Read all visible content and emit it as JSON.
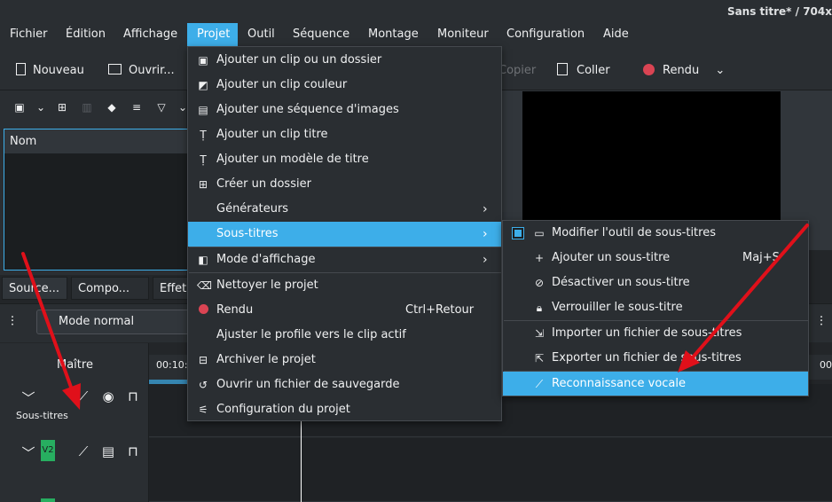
{
  "window": {
    "title": "Sans titre* / 704x"
  },
  "menubar": [
    {
      "label": "Fichier"
    },
    {
      "label": "Édition"
    },
    {
      "label": "Affichage"
    },
    {
      "label": "Projet"
    },
    {
      "label": "Outil"
    },
    {
      "label": "Séquence"
    },
    {
      "label": "Montage"
    },
    {
      "label": "Moniteur"
    },
    {
      "label": "Configuration"
    },
    {
      "label": "Aide"
    }
  ],
  "toolbar": {
    "new_label": "Nouveau",
    "open_label": "Ouvrir...",
    "copy_label": "Copier",
    "paste_label": "Coller",
    "render_label": "Rendu"
  },
  "bin": {
    "column_header": "Nom"
  },
  "tabs": [
    "Source...",
    "Compo...",
    "Effet"
  ],
  "mode": {
    "label": "Mode normal"
  },
  "timeline": {
    "master_label": "Maître",
    "ruler_time": "00:10:",
    "ruler_right": "00",
    "subtitles_track": "Sous-titres",
    "v2_track": "V2"
  },
  "project_menu": {
    "items": [
      {
        "label": "Ajouter un clip ou un dossier",
        "icon": "add-clip-icon"
      },
      {
        "label": "Ajouter un clip couleur",
        "icon": "color-clip-icon"
      },
      {
        "label": "Ajouter une séquence d'images",
        "icon": "image-sequence-icon"
      },
      {
        "label": "Ajouter un clip titre",
        "icon": "title-clip-icon"
      },
      {
        "label": "Ajouter un modèle de titre",
        "icon": "title-template-icon"
      },
      {
        "label": "Créer un dossier",
        "icon": "folder-add-icon"
      },
      {
        "label": "Générateurs",
        "icon": ""
      },
      {
        "label": "Sous-titres",
        "icon": ""
      },
      {
        "label": "Mode d'affichage",
        "icon": "view-mode-icon"
      },
      {
        "label": "Nettoyer le projet",
        "icon": "clean-icon"
      },
      {
        "label": "Rendu",
        "icon": "render-icon",
        "shortcut": "Ctrl+Retour"
      },
      {
        "label": "Ajuster le profile vers le clip actif",
        "icon": ""
      },
      {
        "label": "Archiver le projet",
        "icon": "archive-icon"
      },
      {
        "label": "Ouvrir un fichier de sauvegarde",
        "icon": "backup-icon"
      },
      {
        "label": "Configuration du projet",
        "icon": "settings-icon"
      }
    ]
  },
  "subtitles_menu": {
    "items": [
      {
        "label": "Modifier l'outil de sous-titres",
        "icon": "subtitle-tool-icon",
        "checked": true
      },
      {
        "label": "Ajouter un sous-titre",
        "icon": "plus-icon",
        "shortcut": "Maj+S"
      },
      {
        "label": "Désactiver un sous-titre",
        "icon": "eye-off-icon"
      },
      {
        "label": "Verrouiller le sous-titre",
        "icon": "lock-icon"
      },
      {
        "label": "Importer un fichier de sous-titres",
        "icon": "import-icon"
      },
      {
        "label": "Exporter un fichier de sous-titres",
        "icon": "export-icon"
      },
      {
        "label": "Reconnaissance vocale",
        "icon": "magic-wand-icon"
      }
    ]
  },
  "colors": {
    "accent": "#3daee9",
    "render_red": "#da4453",
    "track_green": "#27ae60",
    "annotation_red": "#e0101a"
  }
}
